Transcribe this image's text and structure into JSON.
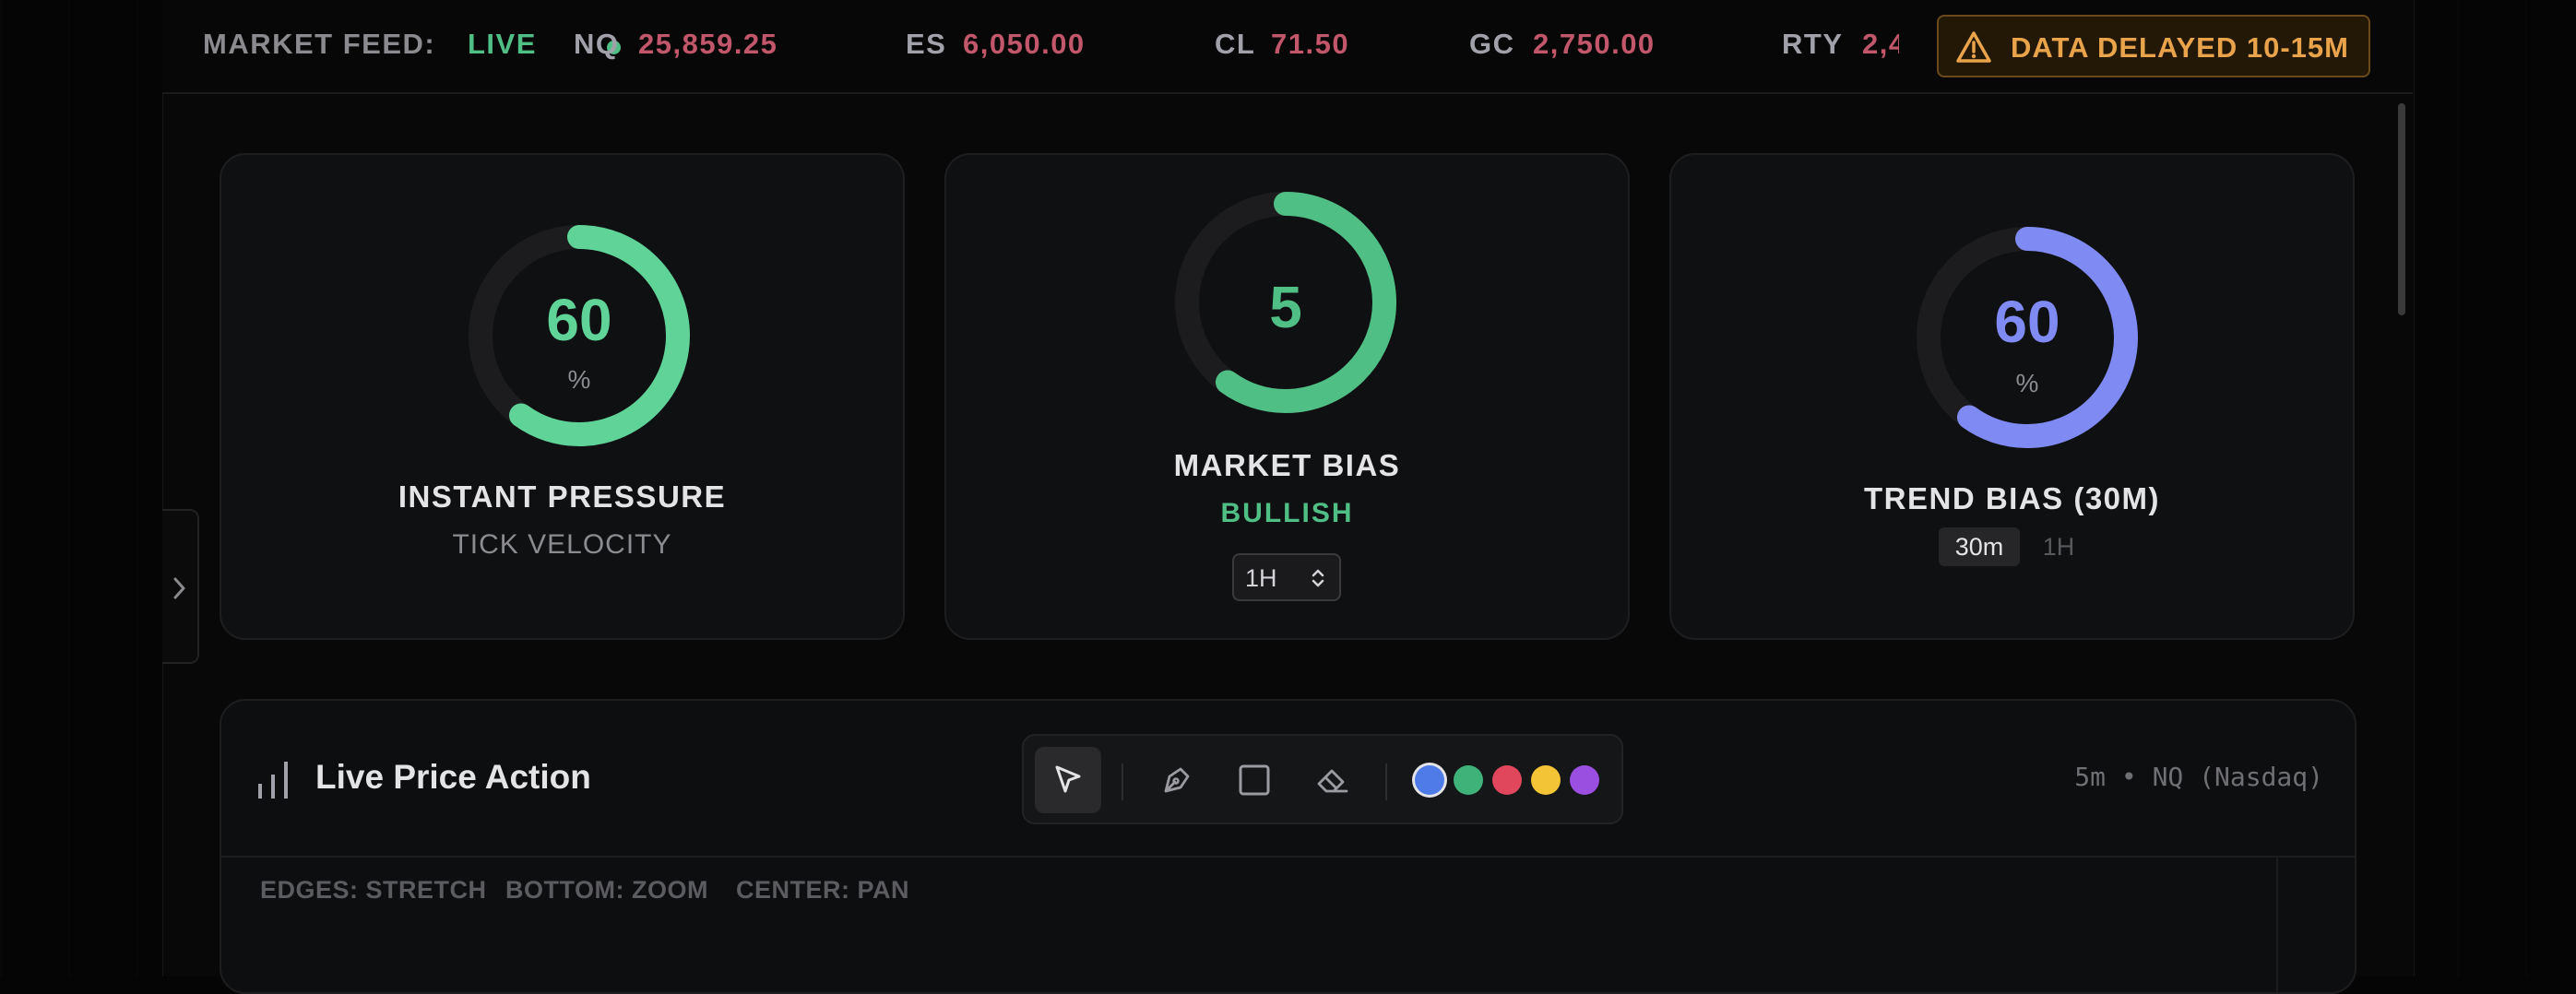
{
  "ticker": {
    "feed_label": "MARKET FEED:",
    "live_label": "LIVE",
    "items": [
      {
        "symbol": "NQ",
        "price": "25,859.25"
      },
      {
        "symbol": "ES",
        "price": "6,050.00"
      },
      {
        "symbol": "CL",
        "price": "71.50"
      },
      {
        "symbol": "GC",
        "price": "2,750.00"
      },
      {
        "symbol": "RTY",
        "price": "2,4"
      }
    ],
    "delayed_label": "DATA DELAYED 10-15M"
  },
  "cards": {
    "instant_pressure": {
      "value": "60",
      "unit": "%",
      "level": 0.6,
      "title": "INSTANT PRESSURE",
      "subtitle": "TICK VELOCITY",
      "color": "#5fd398"
    },
    "market_bias": {
      "value": "5",
      "level": 0.6,
      "title": "MARKET BIAS",
      "subtitle": "BULLISH",
      "color": "#4fbf85",
      "timeframe": "1H"
    },
    "trend_bias": {
      "value": "60",
      "unit": "%",
      "level": 0.6,
      "title": "TREND BIAS (30M)",
      "color": "#7f8bf2",
      "segments": [
        "30m",
        "1H"
      ],
      "active_segment": "30m"
    }
  },
  "price_action": {
    "title": "Live Price Action",
    "meta": "5m • NQ (Nasdaq)",
    "tools": [
      "cursor-icon",
      "pen-icon",
      "rectangle-icon",
      "eraser-icon"
    ],
    "active_tool": "cursor-icon",
    "swatches": [
      "#4f7be8",
      "#3fb27a",
      "#e0465c",
      "#f2c436",
      "#9b4fe0"
    ],
    "selected_swatch": "#4f7be8",
    "hints": [
      "EDGES: STRETCH",
      "BOTTOM: ZOOM",
      "CENTER: PAN"
    ]
  }
}
